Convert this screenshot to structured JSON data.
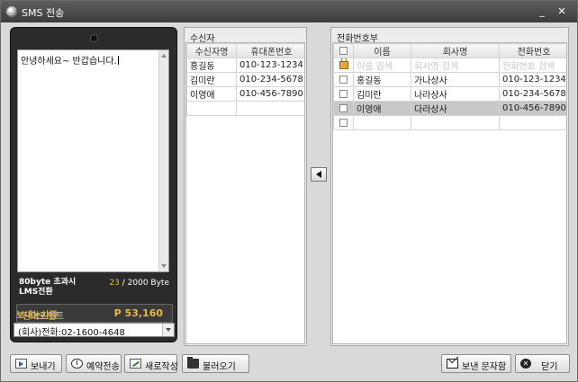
{
  "window": {
    "title": "SMS 전송",
    "minimize_glyph": "_",
    "close_glyph": "✕"
  },
  "phone": {
    "message": "안녕하세요~ 반갑습니다.",
    "lms_line1": "80byte 초과시",
    "lms_line2": "LMS전환",
    "byte_current": "23",
    "byte_max": " / 2000 Byte",
    "points_label": "잔여포인트",
    "points_value": "P 53,160",
    "sender_label": "보내는사람",
    "sender_value": "(회사)전화:02-1600-4648"
  },
  "recipients": {
    "title": "수신자",
    "columns": [
      "수신자명",
      "휴대폰번호"
    ],
    "rows": [
      {
        "name": "홍길동",
        "phone": "010-123-1234"
      },
      {
        "name": "김미란",
        "phone": "010-234-5678"
      },
      {
        "name": "이영애",
        "phone": "010-456-7890"
      }
    ]
  },
  "phonebook": {
    "title": "전화번호부",
    "columns": [
      "이름",
      "회사명",
      "전화번호"
    ],
    "search": {
      "name": "이름 검색",
      "company": "회사명 검색",
      "phone": "전화번호 검색"
    },
    "rows": [
      {
        "name": "홍길동",
        "company": "가나상사",
        "phone": "010-123-1234"
      },
      {
        "name": "김미란",
        "company": "나라상사",
        "phone": "010-234-5678"
      },
      {
        "name": "이영애",
        "company": "다라상사",
        "phone": "010-456-7890"
      }
    ]
  },
  "buttons": {
    "send": "보내기",
    "reserve": "예약전송",
    "new_write": "새로작성",
    "load": "불러오기",
    "sent_box": "보낸 문자함",
    "close": "닫기"
  },
  "icons": {
    "window": "app-icon",
    "move": "arrow-left-icon",
    "search_row": "lock-icon"
  }
}
